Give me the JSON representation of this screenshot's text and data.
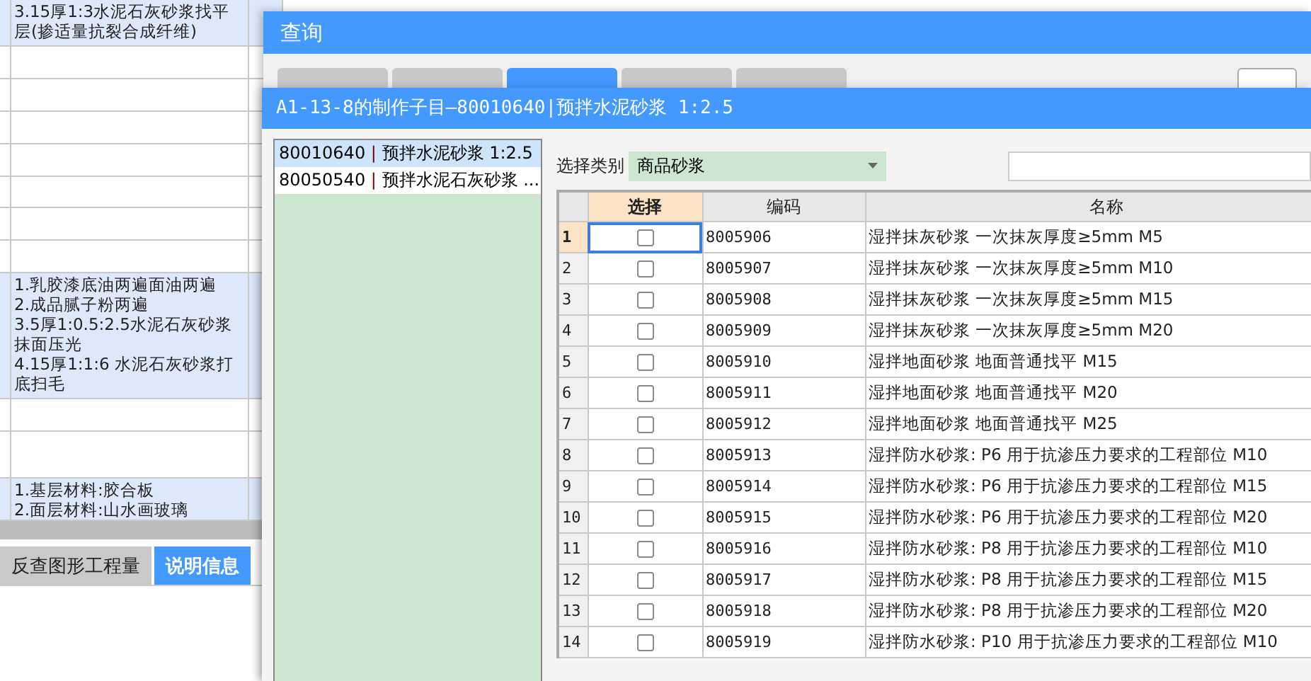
{
  "background_sheet": {
    "rows": [
      {
        "text": "3.15厚1:3水泥石灰砂浆找平层(掺适量抗裂合成纤维)",
        "highlighted": true
      },
      {
        "text": "",
        "highlighted": false
      },
      {
        "text": "",
        "highlighted": false
      },
      {
        "text": "",
        "highlighted": false
      },
      {
        "text": "",
        "highlighted": false
      },
      {
        "text": "",
        "highlighted": false
      },
      {
        "text": "",
        "highlighted": false
      },
      {
        "text": "",
        "highlighted": false
      },
      {
        "text": "1.乳胶漆底油两遍面油两遍\n2.成品腻子粉两遍\n3.5厚1:0.5:2.5水泥石灰砂浆抹面压光\n4.15厚1:1:6 水泥石灰砂浆打底扫毛",
        "highlighted": true
      },
      {
        "text": "",
        "highlighted": false
      },
      {
        "text": "",
        "highlighted": false
      },
      {
        "text": "1.基层材料:胶合板\n2.面层材料:山水画玻璃",
        "highlighted": true
      }
    ],
    "bottom_tabs": [
      {
        "label": "反查图形工程量",
        "selected": false
      },
      {
        "label": "说明信息",
        "selected": true
      }
    ]
  },
  "query_dialog": {
    "title": "查询",
    "tabs": [
      {
        "selected": false
      },
      {
        "selected": false
      },
      {
        "selected": true
      },
      {
        "selected": false
      },
      {
        "selected": false
      }
    ]
  },
  "sub_dialog": {
    "title": "A1-13-8的制作子目—80010640|预拌水泥砂浆 1:2.5",
    "items": [
      {
        "code": "80010640",
        "separator": "|",
        "name": "预拌水泥砂浆 1:2.5",
        "selected": true
      },
      {
        "code": "80050540",
        "separator": "|",
        "name": "预拌水泥石灰砂浆 ...",
        "selected": false
      }
    ],
    "category_label": "选择类别",
    "category": "商品砂浆",
    "table": {
      "columns": [
        "选择",
        "编码",
        "名称"
      ],
      "rows": [
        {
          "no": "1",
          "code": "8005906",
          "name": "湿拌抹灰砂浆 一次抹灰厚度≥5mm M5",
          "checked": false,
          "selected": true
        },
        {
          "no": "2",
          "code": "8005907",
          "name": "湿拌抹灰砂浆 一次抹灰厚度≥5mm M10",
          "checked": false,
          "selected": false
        },
        {
          "no": "3",
          "code": "8005908",
          "name": "湿拌抹灰砂浆 一次抹灰厚度≥5mm M15",
          "checked": false,
          "selected": false
        },
        {
          "no": "4",
          "code": "8005909",
          "name": "湿拌抹灰砂浆 一次抹灰厚度≥5mm M20",
          "checked": false,
          "selected": false
        },
        {
          "no": "5",
          "code": "8005910",
          "name": "湿拌地面砂浆 地面普通找平 M15",
          "checked": false,
          "selected": false
        },
        {
          "no": "6",
          "code": "8005911",
          "name": "湿拌地面砂浆 地面普通找平 M20",
          "checked": false,
          "selected": false
        },
        {
          "no": "7",
          "code": "8005912",
          "name": "湿拌地面砂浆 地面普通找平 M25",
          "checked": false,
          "selected": false
        },
        {
          "no": "8",
          "code": "8005913",
          "name": "湿拌防水砂浆: P6 用于抗渗压力要求的工程部位 M10",
          "checked": false,
          "selected": false
        },
        {
          "no": "9",
          "code": "8005914",
          "name": "湿拌防水砂浆: P6 用于抗渗压力要求的工程部位 M15",
          "checked": false,
          "selected": false
        },
        {
          "no": "10",
          "code": "8005915",
          "name": "湿拌防水砂浆: P6 用于抗渗压力要求的工程部位 M20",
          "checked": false,
          "selected": false
        },
        {
          "no": "11",
          "code": "8005916",
          "name": "湿拌防水砂浆: P8 用于抗渗压力要求的工程部位 M10",
          "checked": false,
          "selected": false
        },
        {
          "no": "12",
          "code": "8005917",
          "name": "湿拌防水砂浆: P8 用于抗渗压力要求的工程部位 M15",
          "checked": false,
          "selected": false
        },
        {
          "no": "13",
          "code": "8005918",
          "name": "湿拌防水砂浆: P8 用于抗渗压力要求的工程部位 M20",
          "checked": false,
          "selected": false
        },
        {
          "no": "14",
          "code": "8005919",
          "name": "湿拌防水砂浆: P10 用于抗渗压力要求的工程部位 M10",
          "checked": false,
          "selected": false
        }
      ]
    }
  }
}
